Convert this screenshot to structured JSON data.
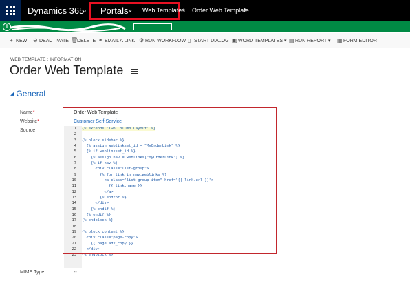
{
  "topnav": {
    "brand": "Dynamics 365",
    "brand_chevron": "⌄",
    "area": "Portals",
    "area_chevron": "⌄",
    "entity": "Web Templates",
    "crumb_sep": "›",
    "record": "Order Web Template",
    "record_chevron": "›"
  },
  "notification": {
    "icon": "i",
    "text": "........ ... ......."
  },
  "commands": [
    {
      "icon": "+",
      "label": "NEW"
    },
    {
      "icon": "⊖",
      "label": "DEACTIVATE"
    },
    {
      "icon": "🗑",
      "label": "DELETE"
    },
    {
      "icon": "⚭",
      "label": "EMAIL A LINK"
    },
    {
      "icon": "⚙",
      "label": "RUN WORKFLOW"
    },
    {
      "icon": "▯",
      "label": "START DIALOG"
    },
    {
      "icon": "▣",
      "label": "WORD TEMPLATES"
    },
    {
      "icon": "▤",
      "label": "RUN REPORT"
    },
    {
      "icon": "▦",
      "label": "FORM EDITOR"
    }
  ],
  "record": {
    "entity_label": "WEB TEMPLATE : INFORMATION",
    "title": "Order Web Template"
  },
  "section": {
    "title": "General"
  },
  "fields": {
    "name_label": "Name",
    "name_value": "Order Web Template",
    "website_label": "Website",
    "website_value": "Customer Self-Service",
    "source_label": "Source",
    "mime_label": "MIME Type",
    "mime_value": "--",
    "required_mark": "*"
  },
  "source_code": [
    {
      "n": "1",
      "code": "{% extends 'Two Column Layout' %}"
    },
    {
      "n": "2",
      "code": ""
    },
    {
      "n": "3",
      "code": "{% block sidebar %}"
    },
    {
      "n": "4",
      "code": "  {% assign weblinkset_id = \"MyOrderLink\" %}"
    },
    {
      "n": "5",
      "code": "  {% if weblinkset_id %}"
    },
    {
      "n": "6",
      "code": "    {% assign nav = weblinks[\"MyOrderLink\"] %}"
    },
    {
      "n": "7",
      "code": "    {% if nav %}"
    },
    {
      "n": "8",
      "code": "      <div class=\"list-group\">"
    },
    {
      "n": "9",
      "code": "        {% for link in nav.weblinks %}"
    },
    {
      "n": "10",
      "code": "          <a class=\"list-group-item\" href=\"{{ link.url }}\">"
    },
    {
      "n": "11",
      "code": "            {{ link.name }}"
    },
    {
      "n": "12",
      "code": "          </a>"
    },
    {
      "n": "13",
      "code": "        {% endfor %}"
    },
    {
      "n": "14",
      "code": "      </div>"
    },
    {
      "n": "15",
      "code": "    {% endif %}"
    },
    {
      "n": "16",
      "code": "  {% endif %}"
    },
    {
      "n": "17",
      "code": "{% endblock %}"
    },
    {
      "n": "18",
      "code": ""
    },
    {
      "n": "19",
      "code": "{% block content %}"
    },
    {
      "n": "20",
      "code": "  <div class=\"page-copy\">"
    },
    {
      "n": "21",
      "code": "    {{ page.adx_copy }}"
    },
    {
      "n": "22",
      "code": "  </div>"
    },
    {
      "n": "23",
      "code": "{% endblock %}"
    }
  ],
  "colors": {
    "nav_bg": "#000000",
    "waffle_bg": "#002050",
    "highlight_border": "#e81123",
    "notification_bg": "#008a44",
    "link": "#1160b7",
    "outline": "#c2272d"
  }
}
